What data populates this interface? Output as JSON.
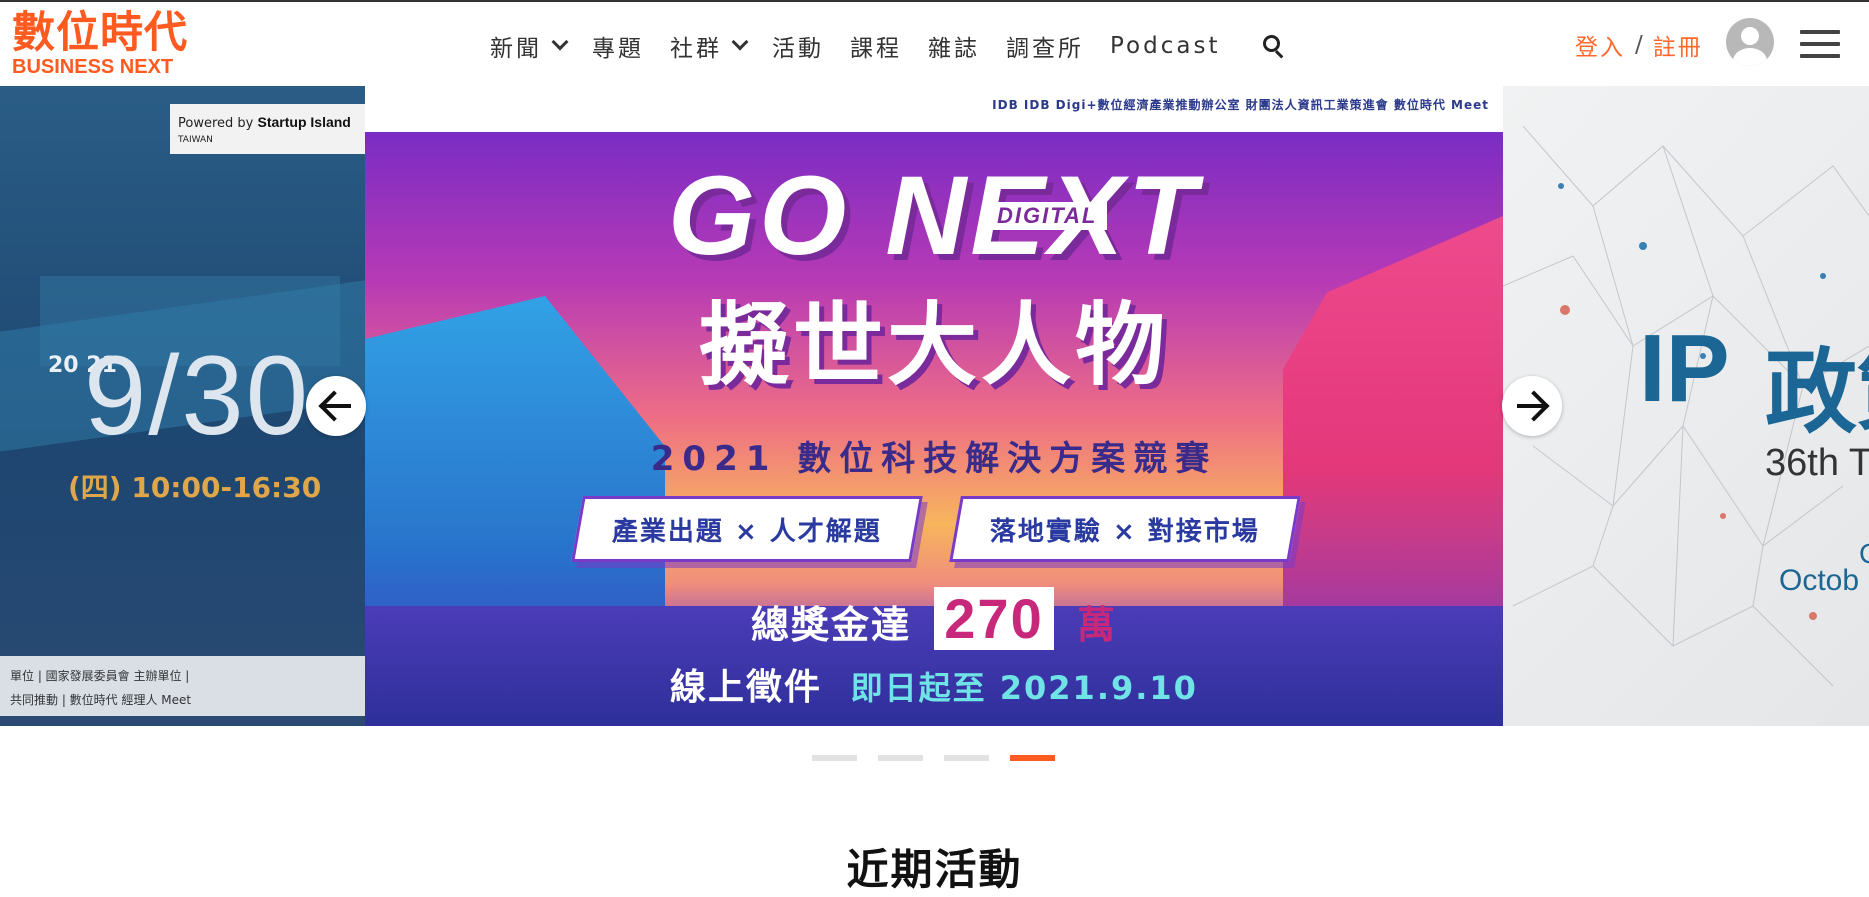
{
  "brand": {
    "name_zh": "數位時代",
    "name_en": "BUSINESS NEXT",
    "color": "#ff5a1f"
  },
  "nav": {
    "items": [
      {
        "label": "新聞",
        "dropdown": true
      },
      {
        "label": "專題",
        "dropdown": false
      },
      {
        "label": "社群",
        "dropdown": true
      },
      {
        "label": "活動",
        "dropdown": false
      },
      {
        "label": "課程",
        "dropdown": false
      },
      {
        "label": "雜誌",
        "dropdown": false
      },
      {
        "label": "調查所",
        "dropdown": false
      },
      {
        "label": "Podcast",
        "dropdown": false
      }
    ],
    "search_icon": "search-icon"
  },
  "auth": {
    "login": "登入",
    "separator": "/",
    "register": "註冊",
    "accent": "#ff6a2b"
  },
  "carousel": {
    "prev_slide": {
      "powered_by": "Powered by",
      "powered_brand": "Startup Island",
      "powered_sub": "TAIWAN",
      "year": "20 21",
      "date": "9/30",
      "time": "(四) 10:00-16:30",
      "orgs_line1": "單位 | 國家發展委員會   主辦單位 |",
      "orgs_line2": "共同推動 | 數位時代 經理人 Meet"
    },
    "main_slide": {
      "sponsors": "IDB  IDB Digi+數位經濟產業推動辦公室  財團法人資訊工業策進會  數位時代  Meet",
      "headline": "GO NEXT",
      "badge": "DIGITAL",
      "title": "擬世大人物",
      "subtitle": "2021 數位科技解決方案競賽",
      "pill1": "產業出題 × 人才解題",
      "pill2": "落地實驗 × 對接市場",
      "prize_prefix": "總獎金達",
      "prize_amount": "270",
      "prize_unit": "萬",
      "deadline_prefix": "線上徵件",
      "deadline_highlight": "即日起至 2021.9.10"
    },
    "next_slide": {
      "headline_en": "IP",
      "headline_zh": "政策",
      "ordinal": "36th T",
      "month": "Octob",
      "partial": "C"
    },
    "prev_label": "arrow-left-icon",
    "next_label": "arrow-right-icon",
    "dots": [
      {
        "active": false
      },
      {
        "active": false
      },
      {
        "active": false
      },
      {
        "active": true
      }
    ]
  },
  "section": {
    "title": "近期活動"
  }
}
